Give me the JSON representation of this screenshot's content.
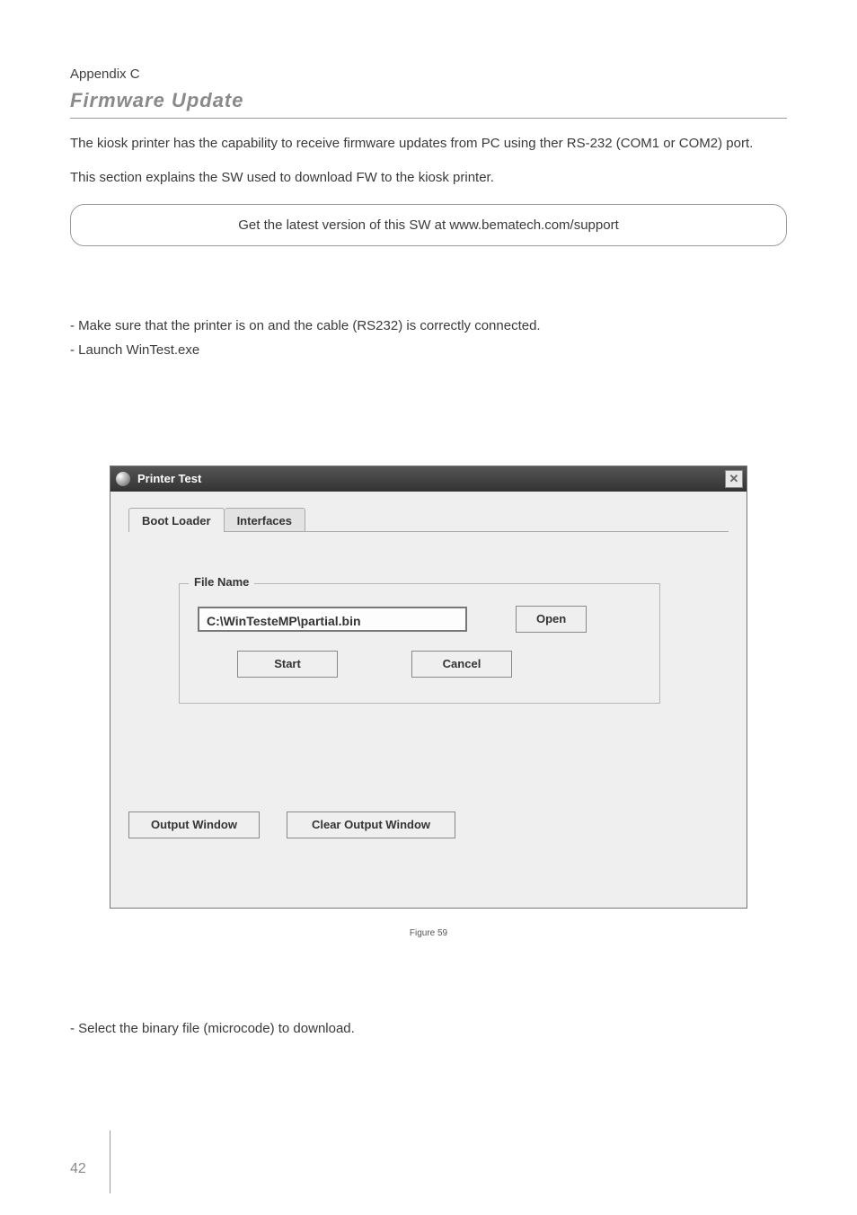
{
  "header": {
    "appendix": "Appendix C",
    "title": "Firmware Update"
  },
  "intro": {
    "p1": "The kiosk printer has the capability to receive firmware updates from PC using ther RS-232 (COM1 or COM2) port.",
    "p2": "This section explains the SW used to download FW to the kiosk printer.",
    "callout": "Get the latest version of this SW at www.bematech.com/support"
  },
  "steps": {
    "s1": "- Make sure that the printer is on and the cable (RS232) is correctly connected.",
    "s2": "- Launch WinTest.exe",
    "s3": "- Select the binary file (microcode) to download."
  },
  "window": {
    "title": "Printer Test",
    "close_glyph": "✕",
    "tabs": {
      "boot": "Boot Loader",
      "interfaces": "Interfaces"
    },
    "group": {
      "legend": "File Name",
      "path": "C:\\WinTesteMP\\partial.bin",
      "open": "Open",
      "start": "Start",
      "cancel": "Cancel"
    },
    "bottom": {
      "output": "Output Window",
      "clear": "Clear Output Window"
    }
  },
  "figure": {
    "label": "Figure 59"
  },
  "page_number": "42"
}
